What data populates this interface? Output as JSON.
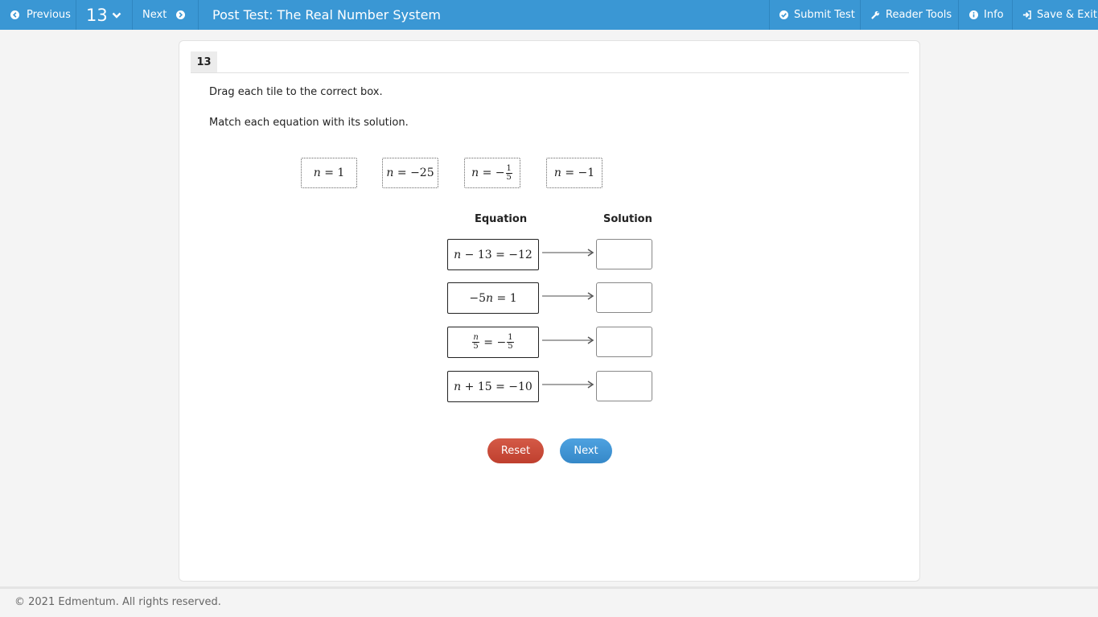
{
  "toolbar": {
    "previous_label": "Previous",
    "question_number": "13",
    "next_label": "Next",
    "title": "Post Test: The Real Number System",
    "submit_label": "Submit Test",
    "reader_tools_label": "Reader Tools",
    "info_label": "Info",
    "save_exit_label": "Save & Exit"
  },
  "question": {
    "number": "13",
    "instruction": "Drag each tile to the correct box.",
    "prompt": "Match each equation with its solution."
  },
  "tiles": [
    {
      "var": "n",
      "op": "=",
      "value": "1"
    },
    {
      "var": "n",
      "op": "=",
      "value": "−25"
    },
    {
      "var": "n",
      "op": "=",
      "sign": "−",
      "num": "1",
      "den": "5"
    },
    {
      "var": "n",
      "op": "=",
      "value": "−1"
    }
  ],
  "headers": {
    "equation": "Equation",
    "solution": "Solution"
  },
  "equations": [
    {
      "lhs_var": "n",
      "lhs_rest": "− 13",
      "op": "=",
      "rhs": "−12"
    },
    {
      "lhs_coef": "−5",
      "lhs_var": "n",
      "op": "=",
      "rhs": "1"
    },
    {
      "lhs_num": "n",
      "lhs_den": "5",
      "op": "=",
      "rhs_sign": "−",
      "rhs_num": "1",
      "rhs_den": "5"
    },
    {
      "lhs_var": "n",
      "lhs_rest": "+ 15",
      "op": "=",
      "rhs": "−10"
    }
  ],
  "buttons": {
    "reset_label": "Reset",
    "next_label": "Next"
  },
  "footer": {
    "copyright": "© 2021 Edmentum. All rights reserved."
  },
  "colors": {
    "toolbar_bg": "#3a97d4",
    "reset_bg": "#c84a37",
    "next_bg": "#3b90d2"
  },
  "icons": {
    "previous": "circle-arrow-left-icon",
    "chevron": "chevron-down-icon",
    "next": "circle-arrow-right-icon",
    "submit": "check-circle-icon",
    "reader_tools": "wrench-icon",
    "info": "info-circle-icon",
    "save_exit": "sign-out-icon"
  }
}
